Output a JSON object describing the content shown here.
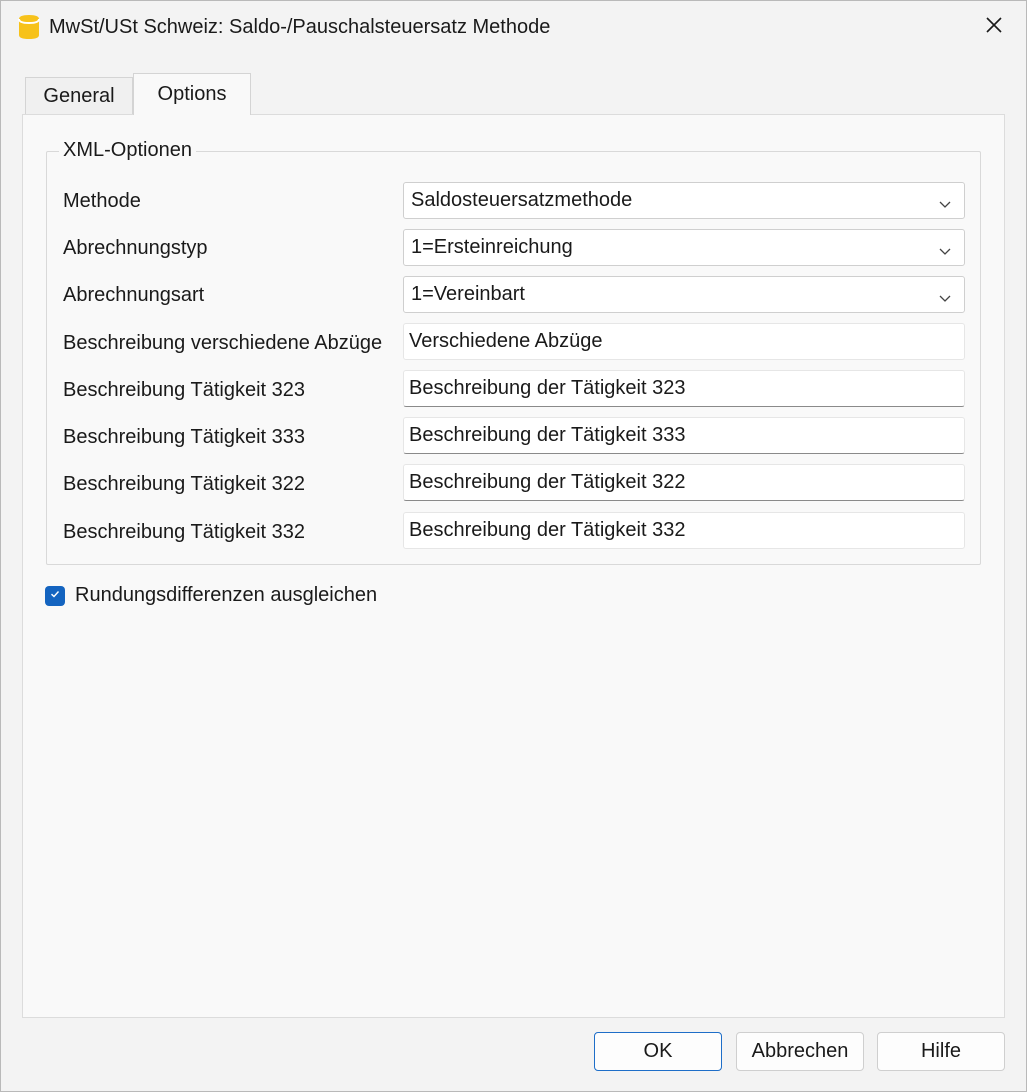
{
  "window": {
    "title": "MwSt/USt Schweiz: Saldo-/Pauschalsteuersatz Methode",
    "app_icon": "database-cylinder-icon",
    "close_icon": "close-icon"
  },
  "tabs": [
    {
      "label": "General",
      "active": false
    },
    {
      "label": "Options",
      "active": true
    }
  ],
  "group": {
    "title": "XML-Optionen",
    "rows": [
      {
        "label": "Methode",
        "type": "select",
        "value": "Saldosteuersatzmethode"
      },
      {
        "label": "Abrechnungstyp",
        "type": "select",
        "value": "1=Ersteinreichung"
      },
      {
        "label": "Abrechnungsart",
        "type": "select",
        "value": "1=Vereinbart"
      },
      {
        "label": "Beschreibung verschiedene Abzüge",
        "type": "text",
        "value": "Verschiedene Abzüge"
      },
      {
        "label": "Beschreibung Tätigkeit 323",
        "type": "text",
        "value": "Beschreibung der Tätigkeit 323"
      },
      {
        "label": "Beschreibung Tätigkeit 333",
        "type": "text",
        "value": "Beschreibung der Tätigkeit 333"
      },
      {
        "label": "Beschreibung Tätigkeit 322",
        "type": "text",
        "value": "Beschreibung der Tätigkeit 322"
      },
      {
        "label": "Beschreibung Tätigkeit 332",
        "type": "text",
        "value": "Beschreibung der Tätigkeit 332"
      }
    ]
  },
  "checkbox": {
    "label": "Rundungsdifferenzen ausgleichen",
    "checked": true
  },
  "buttons": {
    "ok": "OK",
    "cancel": "Abbrechen",
    "help": "Hilfe"
  },
  "colors": {
    "accent": "#1464c0",
    "icon_yellow": "#f7c21b"
  }
}
